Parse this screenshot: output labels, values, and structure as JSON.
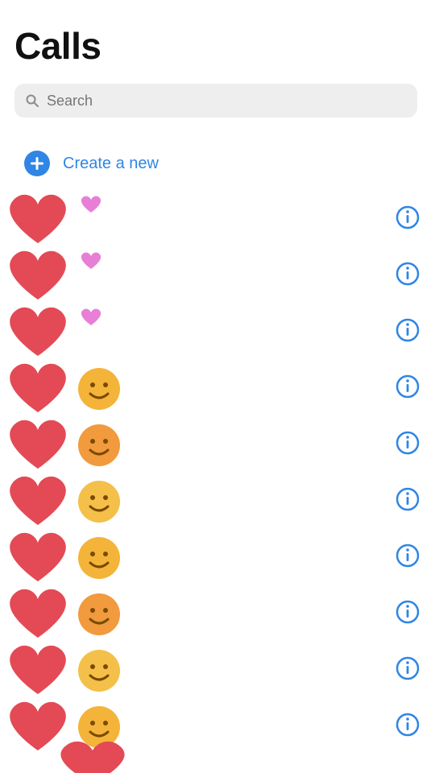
{
  "header": {
    "title": "Calls"
  },
  "search": {
    "placeholder": "Search"
  },
  "add_contact": {
    "label": "Create a new"
  },
  "calls": [
    {
      "name": "",
      "subtitle": "",
      "time": "",
      "lead": "heart-pink"
    },
    {
      "name": "",
      "subtitle": "",
      "time": "",
      "lead": "heart-pink"
    },
    {
      "name": "",
      "subtitle": "",
      "time": "",
      "lead": "heart-pink"
    },
    {
      "name": "",
      "subtitle": "",
      "time": "",
      "lead": "face"
    },
    {
      "name": "",
      "subtitle": "",
      "time": "",
      "lead": "face"
    },
    {
      "name": "",
      "subtitle": "",
      "time": "",
      "lead": "face"
    },
    {
      "name": "",
      "subtitle": "",
      "time": "",
      "lead": "face"
    },
    {
      "name": "",
      "subtitle": "",
      "time": "",
      "lead": "face"
    },
    {
      "name": "",
      "subtitle": "",
      "time": "",
      "lead": "face"
    },
    {
      "name": "",
      "subtitle": "",
      "time": "",
      "lead": "face"
    }
  ],
  "colors": {
    "accent": "#2f86e4",
    "heart": "#e34a55",
    "pink": "#e87fd6",
    "face": "#f4b43a",
    "muted": "#8a8a8e"
  },
  "icons": {
    "search": "search-icon",
    "add": "plus-circle-icon",
    "info": "info-icon",
    "avatar": "heart-icon"
  }
}
